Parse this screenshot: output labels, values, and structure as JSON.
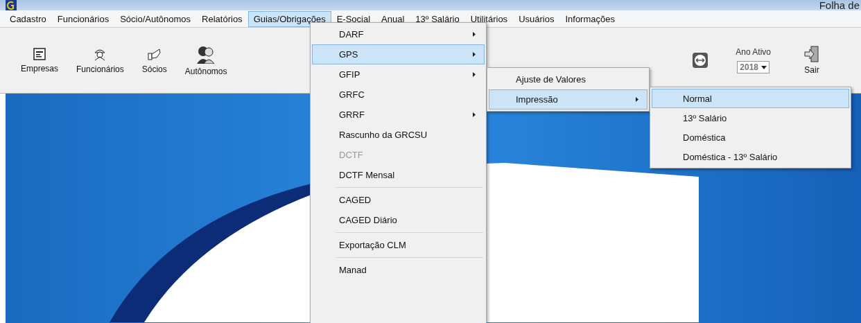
{
  "window": {
    "title": "Folha de"
  },
  "menu_bar": [
    {
      "label": "Cadastro",
      "selected": false
    },
    {
      "label": "Funcionários",
      "selected": false
    },
    {
      "label": "Sócio/Autônomos",
      "selected": false
    },
    {
      "label": "Relatórios",
      "selected": false
    },
    {
      "label": "Guias/Obrigações",
      "selected": true
    },
    {
      "label": "E-Social",
      "selected": false
    },
    {
      "label": "Anual",
      "selected": false
    },
    {
      "label": "13º Salário",
      "selected": false
    },
    {
      "label": "Utilitários",
      "selected": false
    },
    {
      "label": "Usuários",
      "selected": false
    },
    {
      "label": "Informações",
      "selected": false
    }
  ],
  "toolbar": [
    {
      "label": "Empresas",
      "kind": "form"
    },
    {
      "label": "Funcionários",
      "kind": "worker"
    },
    {
      "label": "Sócios",
      "kind": "hand"
    },
    {
      "label": "Autônomos",
      "kind": "people"
    }
  ],
  "year_selector": {
    "label": "Ano Ativo",
    "value": "2018"
  },
  "exit_button": {
    "label": "Sair"
  },
  "menu": {
    "groups": [
      [
        {
          "label": "DARF",
          "submenu": true,
          "disabled": false,
          "selected": false
        },
        {
          "label": "GPS",
          "submenu": true,
          "disabled": false,
          "selected": true
        },
        {
          "label": "GFIP",
          "submenu": true,
          "disabled": false,
          "selected": false
        },
        {
          "label": "GRFC",
          "submenu": false,
          "disabled": false,
          "selected": false
        },
        {
          "label": "GRRF",
          "submenu": true,
          "disabled": false,
          "selected": false
        },
        {
          "label": "Rascunho da GRCSU",
          "submenu": false,
          "disabled": false,
          "selected": false
        },
        {
          "label": "DCTF",
          "submenu": false,
          "disabled": true,
          "selected": false
        },
        {
          "label": "DCTF Mensal",
          "submenu": false,
          "disabled": false,
          "selected": false
        }
      ],
      [
        {
          "label": "CAGED",
          "submenu": false,
          "disabled": false,
          "selected": false
        },
        {
          "label": "CAGED Diário",
          "submenu": false,
          "disabled": false,
          "selected": false
        }
      ],
      [
        {
          "label": "Exportação CLM",
          "submenu": false,
          "disabled": false,
          "selected": false
        }
      ],
      [
        {
          "label": "Manad",
          "submenu": false,
          "disabled": false,
          "selected": false
        }
      ]
    ]
  },
  "gps_submenu": [
    {
      "label": "Ajuste de Valores",
      "submenu": false,
      "selected": false
    },
    {
      "label": "Impressão",
      "submenu": true,
      "selected": true
    }
  ],
  "impressao_submenu": [
    {
      "label": "Normal",
      "selected": true
    },
    {
      "label": "13º Salário",
      "selected": false
    },
    {
      "label": "Doméstica",
      "selected": false
    },
    {
      "label": "Doméstica - 13º Salário",
      "selected": false
    }
  ]
}
